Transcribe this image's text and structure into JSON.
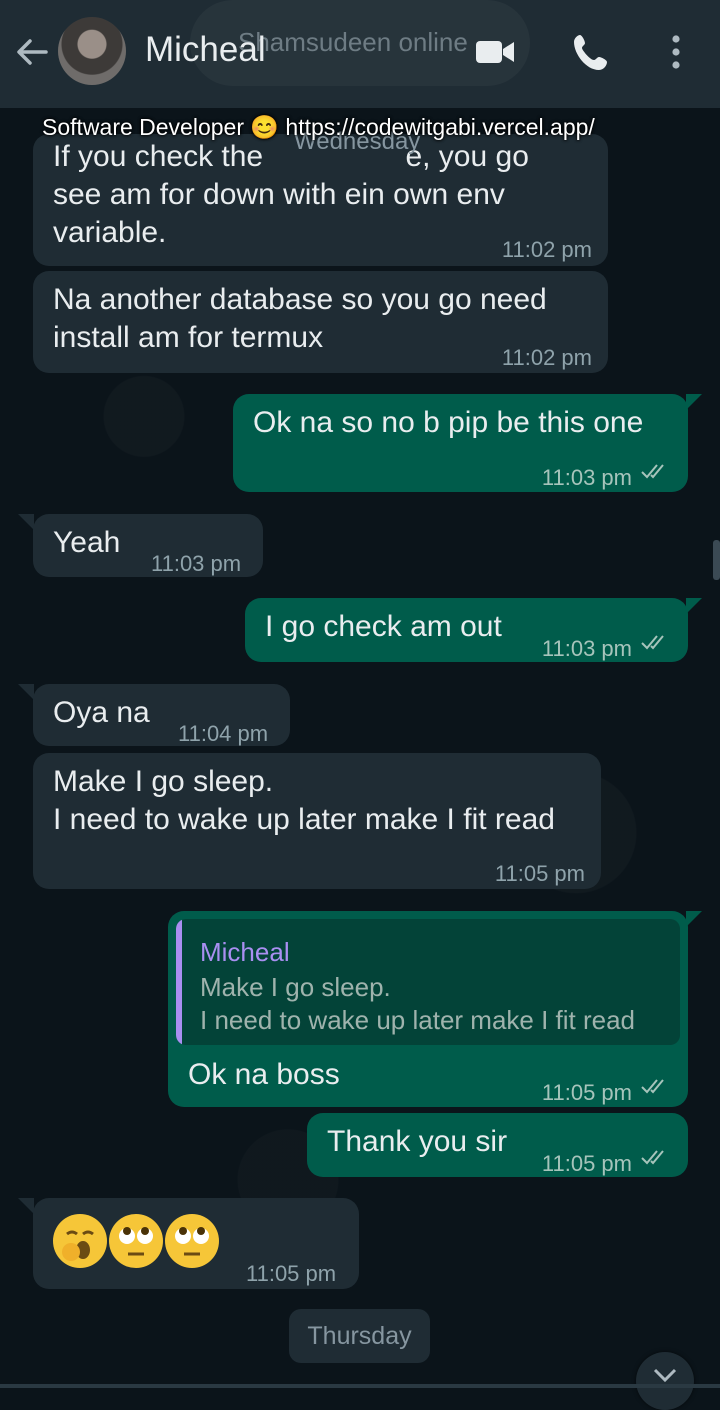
{
  "header": {
    "contact_name": "Micheal",
    "ghost_status": "Shamsudeen online",
    "subtitle": "Software Developer 😊 https://codewitgabi.vercel.app/",
    "ghost_date": "Wednesday",
    "icons": [
      "back-arrow-icon",
      "avatar",
      "video-call-icon",
      "phone-icon",
      "more-options-icon"
    ]
  },
  "messages": [
    {
      "dir": "in",
      "text_lines": [
        "If you check the ",
        "see am for down with ein own env",
        "variable."
      ],
      "partial_suffix": "e, you go",
      "time": "11:02 pm"
    },
    {
      "dir": "in",
      "text_lines": [
        "Na another database so you go need",
        "install am for termux"
      ],
      "time": "11:02 pm"
    },
    {
      "dir": "out",
      "text": "Ok na so no b pip be this one",
      "time": "11:03 pm"
    },
    {
      "dir": "in",
      "text": "Yeah",
      "time": "11:03 pm"
    },
    {
      "dir": "out",
      "text": "I go check am out",
      "time": "11:03 pm"
    },
    {
      "dir": "in",
      "text": "Oya na",
      "time": "11:04 pm"
    },
    {
      "dir": "in",
      "text_lines": [
        "Make I go sleep.",
        "I need to wake up later make I fit read"
      ],
      "time": "11:05 pm"
    },
    {
      "dir": "out",
      "quote_name": "Micheal",
      "quote_lines": [
        "Make I go sleep.",
        "I need to wake up later make I fit read"
      ],
      "text": "Ok na boss",
      "time": "11:05 pm"
    },
    {
      "dir": "out",
      "text": "Thank you sir",
      "time": "11:05 pm"
    },
    {
      "dir": "in",
      "emojis": [
        "🥱",
        "🙄",
        "🙄"
      ],
      "time": "11:05 pm"
    }
  ],
  "day_divider": "Thursday",
  "colors": {
    "incoming": "#1f2c34",
    "outgoing": "#005c4b",
    "quote_accent": "#a98ff1",
    "tick": "#a6c4bb"
  }
}
